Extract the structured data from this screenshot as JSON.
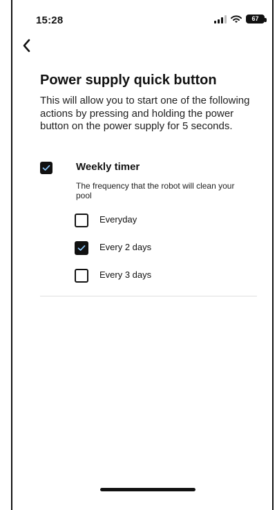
{
  "status_bar": {
    "time": "15:28",
    "battery": "67",
    "signal_icon": "cellular-signal-icon",
    "wifi_icon": "wifi-icon",
    "battery_icon": "battery-icon"
  },
  "navigation": {
    "back_icon": "chevron-left-icon"
  },
  "page": {
    "title": "Power supply quick button",
    "description": "This will allow you to start one of the following actions by pressing and holding the power button on the power supply for 5 seconds."
  },
  "weekly_timer": {
    "label": "Weekly timer",
    "description": "The frequency that the robot will clean your pool",
    "checked": true
  },
  "frequency_options": [
    {
      "label": "Everyday",
      "checked": false
    },
    {
      "label": "Every 2 days",
      "checked": true
    },
    {
      "label": "Every 3 days",
      "checked": false
    }
  ],
  "colors": {
    "primary_text": "#111111",
    "checkbox_fill": "#111111",
    "checkmark": "#8ecbff",
    "divider": "#dfdfdf"
  }
}
